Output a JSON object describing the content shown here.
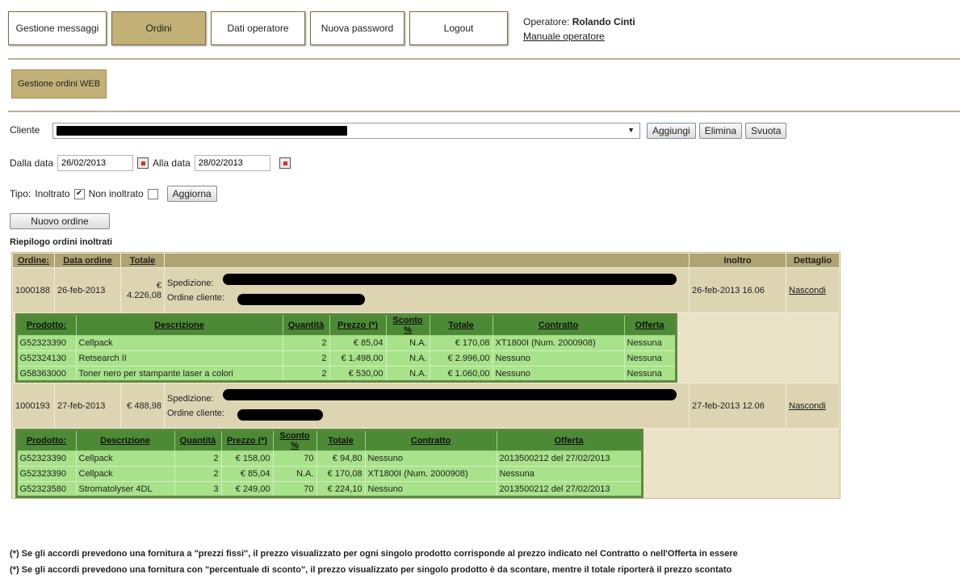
{
  "nav": {
    "items": [
      {
        "label": "Gestione messaggi",
        "active": false
      },
      {
        "label": "Ordini",
        "active": true
      },
      {
        "label": "Dati operatore",
        "active": false
      },
      {
        "label": "Nuova password",
        "active": false
      },
      {
        "label": "Logout",
        "active": false
      }
    ],
    "operator_prefix": "Operatore: ",
    "operator_name": "Rolando Cinti",
    "manual_link": "Manuale operatore"
  },
  "sub": {
    "button": "Gestione ordini WEB"
  },
  "filters": {
    "cliente_label": "Cliente",
    "add": "Aggiungi",
    "delete": "Elimina",
    "clear": "Svuota",
    "from_label": "Dalla data",
    "from_value": "26/02/2013",
    "to_label": "Alla data",
    "to_value": "28/02/2013",
    "tipo_label": "Tipo:",
    "inoltrato_label": "Inoltrato",
    "non_inoltrato_label": "Non inoltrato",
    "refresh": "Aggiorna",
    "new_order": "Nuovo ordine"
  },
  "section_title": "Riepilogo ordini inoltrati",
  "orders_header": {
    "ordine": "Ordine:",
    "data": "Data ordine",
    "totale": "Totale",
    "inoltro": "Inoltro",
    "dettaglio": "Dettaglio"
  },
  "orders": [
    {
      "id": "1000188",
      "date": "26-feb-2013",
      "total": "€ 4.226,08",
      "spedizione_label": "Spedizione:",
      "cliente_label": "Ordine cliente:",
      "inoltro": "26-feb-2013 16.06",
      "detail_link": "Nascondi",
      "products_header": [
        "Prodotto:",
        "Descrizione",
        "Quantità",
        "Prezzo (*)",
        "Sconto %",
        "Totale",
        "Contratto",
        "Offerta"
      ],
      "products": [
        [
          "G52323390",
          "Cellpack",
          "2",
          "€ 85,04",
          "N.A.",
          "€ 170,08",
          "XT1800I (Num. 2000908)",
          "Nessuna"
        ],
        [
          "G52324130",
          "Retsearch II",
          "2",
          "€ 1.498,00",
          "N.A.",
          "€ 2.996,00",
          "Nessuno",
          "Nessuna"
        ],
        [
          "G58363000",
          "Toner nero per stampante laser a colori",
          "2",
          "€ 530,00",
          "N.A.",
          "€ 1.060,00",
          "Nessuno",
          "Nessuna"
        ]
      ]
    },
    {
      "id": "1000193",
      "date": "27-feb-2013",
      "total": "€ 488,98",
      "spedizione_label": "Spedizione:",
      "cliente_label": "Ordine cliente:",
      "inoltro": "27-feb-2013 12.06",
      "detail_link": "Nascondi",
      "products_header": [
        "Prodotto:",
        "Descrizione",
        "Quantità",
        "Prezzo (*)",
        "Sconto %",
        "Totale",
        "Contratto",
        "Offerta"
      ],
      "products": [
        [
          "G52323390",
          "Cellpack",
          "2",
          "€ 158,00",
          "70",
          "€ 94,80",
          "Nessuno",
          "2013500212 del 27/02/2013"
        ],
        [
          "G52323390",
          "Cellpack",
          "2",
          "€ 85,04",
          "N.A.",
          "€ 170,08",
          "XT1800I (Num. 2000908)",
          "Nessuna"
        ],
        [
          "G52323580",
          "Stromatolyser 4DL",
          "3",
          "€ 249,00",
          "70",
          "€ 224,10",
          "Nessuno",
          "2013500212 del 27/02/2013"
        ]
      ]
    }
  ],
  "footnotes": [
    "(*) Se gli accordi prevedono una fornitura a \"prezzi fissi\", il prezzo visualizzato per ogni singolo prodotto corrisponde al prezzo indicato nel Contratto o nell'Offerta in essere",
    "(*) Se gli accordi prevedono una fornitura con \"percentuale di sconto\", il prezzo visualizzato per singolo prodotto è da scontare, mentre il totale riporterà il prezzo scontato"
  ]
}
